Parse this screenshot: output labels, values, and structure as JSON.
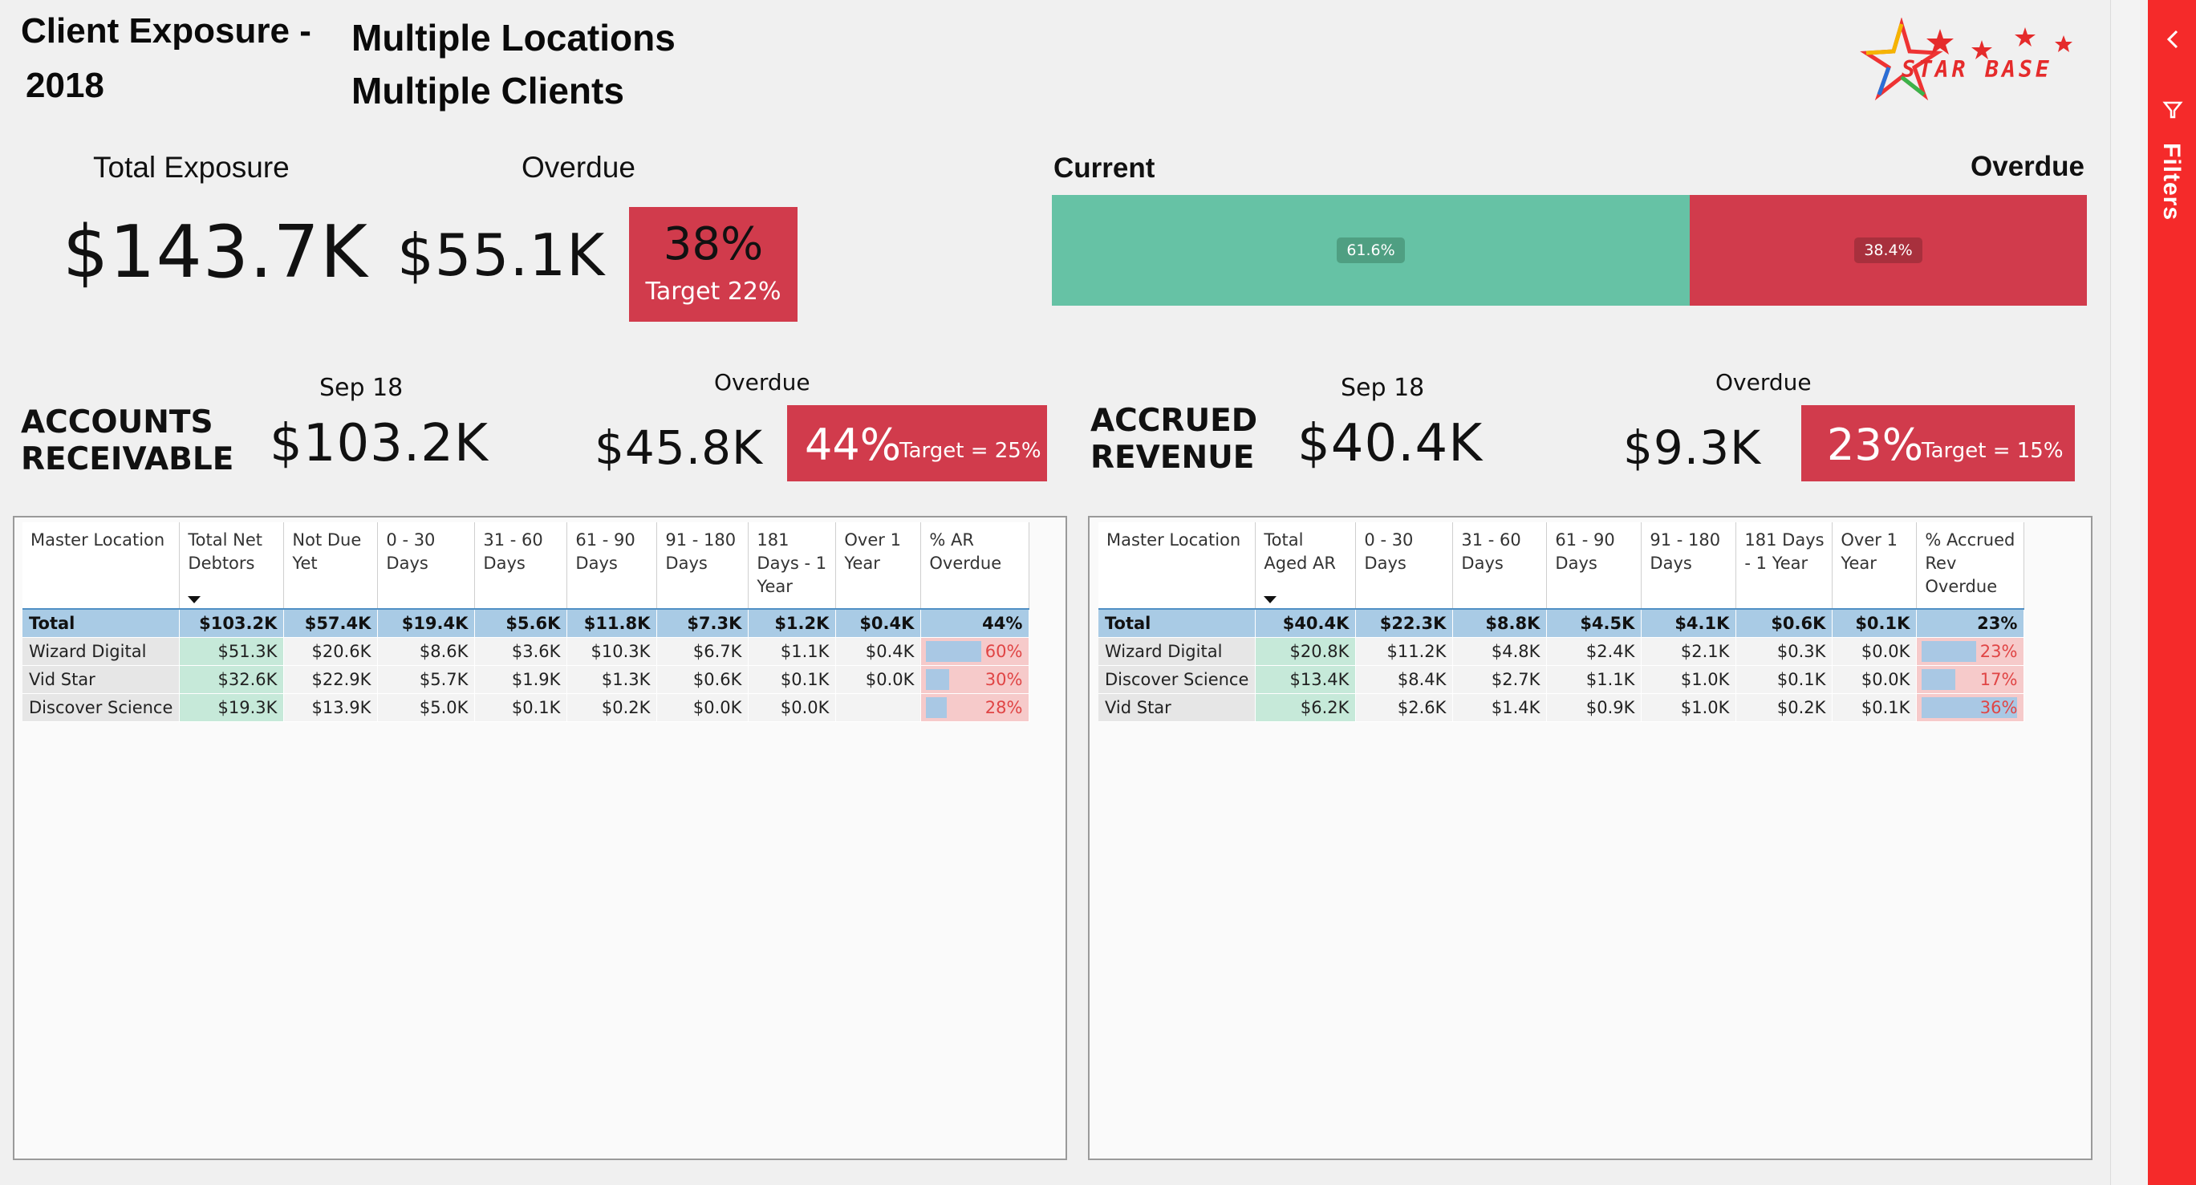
{
  "header": {
    "title_line1": "Client Exposure -",
    "title_line2": "2018",
    "subtitle_line1": "Multiple Locations",
    "subtitle_line2": "Multiple Clients",
    "logo_text": "STAR BASE"
  },
  "kpis": {
    "total_exposure_label": "Total Exposure",
    "total_exposure_value": "$143.7K",
    "overdue_label": "Overdue",
    "overdue_value": "$55.1K",
    "overdue_pct": "38%",
    "overdue_target": "Target 22%"
  },
  "current_vs_overdue": {
    "current_label": "Current",
    "overdue_label": "Overdue",
    "current_pct_label": "61.6%",
    "overdue_pct_label": "38.4%",
    "current_fraction": 0.616,
    "overdue_fraction": 0.384,
    "current_color": "#66c2a5",
    "overdue_color": "#d13b4c"
  },
  "ar": {
    "title_line1": "ACCOUNTS",
    "title_line2": "RECEIVABLE",
    "period_label": "Sep 18",
    "value": "$103.2K",
    "overdue_label": "Overdue",
    "overdue_value": "$45.8K",
    "overdue_pct": "44%",
    "target": "Target = 25%"
  },
  "accrued": {
    "title_line1": "ACCRUED",
    "title_line2": "REVENUE",
    "period_label": "Sep 18",
    "value": "$40.4K",
    "overdue_label": "Overdue",
    "overdue_value": "$9.3K",
    "overdue_pct": "23%",
    "target": "Target = 15%"
  },
  "ar_table": {
    "columns": [
      "Master Location",
      "Total Net Debtors",
      "Not Due Yet",
      "0 - 30 Days",
      "31 - 60 Days",
      "61 - 90 Days",
      "91 - 180 Days",
      "181 Days - 1 Year",
      "Over 1 Year",
      "% AR Overdue"
    ],
    "total": [
      "Total",
      "$103.2K",
      "$57.4K",
      "$19.4K",
      "$5.6K",
      "$11.8K",
      "$7.3K",
      "$1.2K",
      "$0.4K",
      "44%"
    ],
    "rows": [
      [
        "Wizard Digital",
        "$51.3K",
        "$20.6K",
        "$8.6K",
        "$3.6K",
        "$10.3K",
        "$6.7K",
        "$1.1K",
        "$0.4K",
        "60%"
      ],
      [
        "Vid Star",
        "$32.6K",
        "$22.9K",
        "$5.7K",
        "$1.9K",
        "$1.3K",
        "$0.6K",
        "$0.1K",
        "$0.0K",
        "30%"
      ],
      [
        "Discover Science",
        "$19.3K",
        "$13.9K",
        "$5.0K",
        "$0.1K",
        "$0.2K",
        "$0.0K",
        "$0.0K",
        "",
        "28%"
      ]
    ],
    "pct_fractions": [
      0.6,
      0.3,
      0.28
    ]
  },
  "accrued_table": {
    "columns": [
      "Master Location",
      "Total Aged AR",
      "0 - 30 Days",
      "31 - 60 Days",
      "61 - 90 Days",
      "91 - 180 Days",
      "181 Days - 1 Year",
      "Over 1 Year",
      "% Accrued Rev Overdue"
    ],
    "total": [
      "Total",
      "$40.4K",
      "$22.3K",
      "$8.8K",
      "$4.5K",
      "$4.1K",
      "$0.6K",
      "$0.1K",
      "23%"
    ],
    "rows": [
      [
        "Wizard Digital",
        "$20.8K",
        "$11.2K",
        "$4.8K",
        "$2.4K",
        "$2.1K",
        "$0.3K",
        "$0.0K",
        "23%"
      ],
      [
        "Discover Science",
        "$13.4K",
        "$8.4K",
        "$2.7K",
        "$1.1K",
        "$1.0K",
        "$0.1K",
        "$0.0K",
        "17%"
      ],
      [
        "Vid Star",
        "$6.2K",
        "$2.6K",
        "$1.4K",
        "$0.9K",
        "$1.0K",
        "$0.2K",
        "$0.1K",
        "36%"
      ]
    ],
    "pct_fractions": [
      0.6,
      0.4,
      0.98
    ]
  },
  "rail": {
    "filters_label": "Filters",
    "color": "#f52a2a"
  }
}
